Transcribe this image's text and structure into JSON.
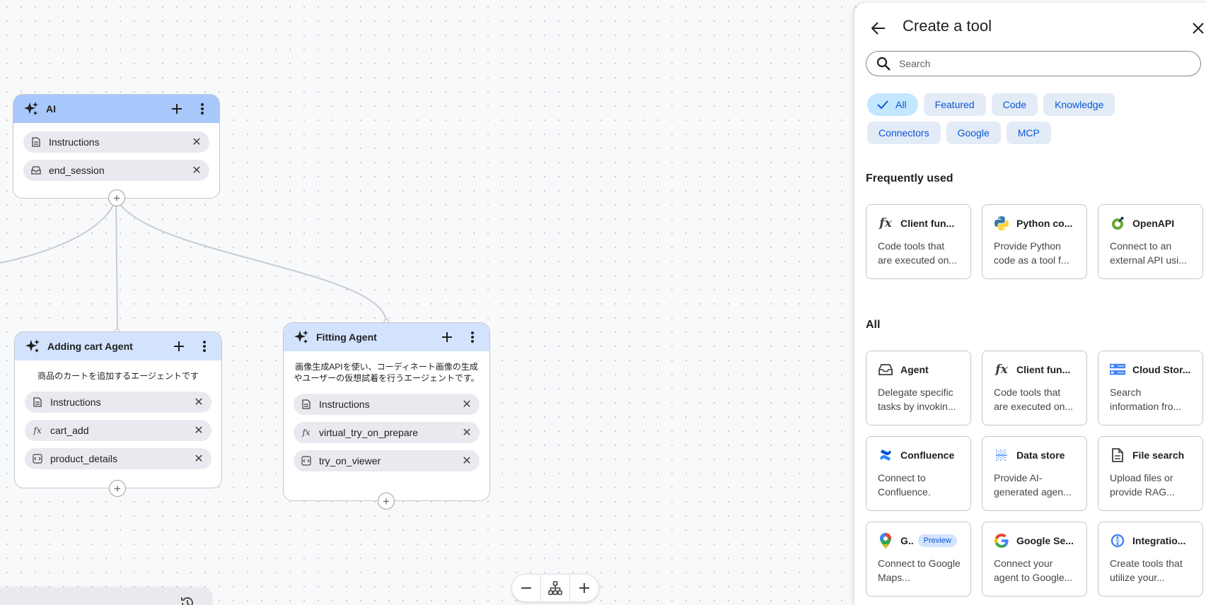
{
  "canvas": {
    "agents": [
      {
        "title": "AI",
        "active": true,
        "tools": [
          {
            "label": "Instructions",
            "icon": "doc-icon"
          },
          {
            "label": "end_session",
            "icon": "inbox-icon"
          }
        ]
      },
      {
        "title": "Adding cart Agent",
        "description": "商品のカートを追加するエージェントです",
        "tools": [
          {
            "label": "Instructions",
            "icon": "doc-icon"
          },
          {
            "label": "cart_add",
            "icon": "function-icon"
          },
          {
            "label": "product_details",
            "icon": "code-icon"
          }
        ]
      },
      {
        "title": "Fitting Agent",
        "description": "画像生成APIを使い、コーディネート画像の生成やユーザーの仮想試着を行うエージェントです。",
        "tools": [
          {
            "label": "Instructions",
            "icon": "doc-icon"
          },
          {
            "label": "virtual_try_on_prepare",
            "icon": "function-icon"
          },
          {
            "label": "try_on_viewer",
            "icon": "code-icon"
          }
        ]
      }
    ],
    "zoom_controls": [
      "zoom-out",
      "fit-layout",
      "zoom-in"
    ]
  },
  "panel": {
    "title": "Create a tool",
    "search_placeholder": "Search",
    "filters": {
      "row1": [
        "All",
        "Featured",
        "Code",
        "Knowledge"
      ],
      "row2": [
        "Connectors",
        "Google",
        "MCP"
      ],
      "selected": "All"
    },
    "frequently_used_title": "Frequently used",
    "frequently_used": [
      {
        "name": "Client fun...",
        "desc": "Code tools that are executed on...",
        "icon": "function-icon"
      },
      {
        "name": "Python co...",
        "desc": "Provide Python code as a tool f...",
        "icon": "python-icon"
      },
      {
        "name": "OpenAPI",
        "desc": "Connect to an external API usi...",
        "icon": "openapi-icon"
      }
    ],
    "all_title": "All",
    "all_tools": [
      {
        "name": "Agent",
        "desc": "Delegate specific tasks by invokin...",
        "icon": "agent-icon"
      },
      {
        "name": "Client fun...",
        "desc": "Code tools that are executed on...",
        "icon": "function-icon"
      },
      {
        "name": "Cloud Stor...",
        "desc": "Search information fro...",
        "icon": "cloud-storage-icon"
      },
      {
        "name": "Confluence",
        "desc": "Connect to Confluence.",
        "icon": "confluence-icon"
      },
      {
        "name": "Data store",
        "desc": "Provide AI-generated agen...",
        "icon": "data-store-icon"
      },
      {
        "name": "File search",
        "desc": "Upload files or provide RAG...",
        "icon": "file-search-icon"
      },
      {
        "name": "G..",
        "badge": "Preview",
        "desc": "Connect to Google Maps...",
        "icon": "google-maps-icon"
      },
      {
        "name": "Google Se...",
        "desc": "Connect your agent to Google...",
        "icon": "google-icon"
      },
      {
        "name": "Integratio...",
        "desc": "Create tools that utilize your...",
        "icon": "integration-icon"
      }
    ]
  }
}
